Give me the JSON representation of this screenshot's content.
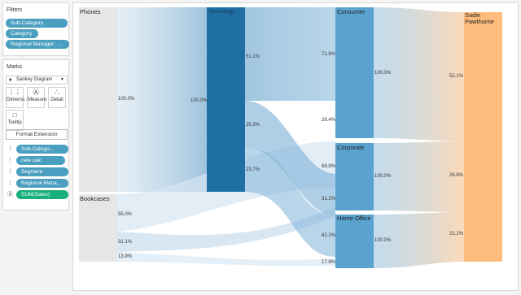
{
  "filters": {
    "title": "Filters",
    "pills": [
      "Sub-Category",
      "Category",
      "Regional Manager: S..."
    ]
  },
  "marks": {
    "title": "Marks",
    "mark_type": "Sankey Diagram",
    "buttons": [
      "Dimensi...",
      "Measure",
      "Detail",
      "Tooltip"
    ],
    "format_extension": "Format Extension",
    "fields": [
      "Sub-Catego...",
      "new calc",
      "Segment",
      "Regional Mana...",
      "SUM(Sales)"
    ]
  },
  "viz": {
    "nodes": {
      "phones": "Phones",
      "bookcases": "Bookcases",
      "technology": "Technology",
      "consumer": "Consumer",
      "corporate": "Corporate",
      "home_office": "Home Office",
      "manager": "Sadie Pawthorne"
    },
    "labels": {
      "phones_pct": "100.0%",
      "tech_in_pct": "100.0%",
      "tech_out_1": "51.1%",
      "tech_out_2": "25.3%",
      "tech_out_3": "23.7%",
      "book_out_1": "55.0%",
      "book_out_2": "31.1%",
      "book_out_3": "13.9%",
      "consumer_in_1": "71.6%",
      "consumer_in_2": "28.4%",
      "corporate_in_1": "68.8%",
      "corporate_in_2": "31.2%",
      "home_in_1": "82.2%",
      "home_in_2": "17.8%",
      "consumer_out": "100.0%",
      "corporate_out": "100.0%",
      "home_out": "100.0%",
      "mgr_in_1": "52.1%",
      "mgr_in_2": "26.8%",
      "mgr_in_3": "21.1%"
    },
    "colors": {
      "technology": "#1f6fa5",
      "segment": "#5aa3cf",
      "manager": "#fdbb7c",
      "source": "#e4e4e4"
    }
  }
}
